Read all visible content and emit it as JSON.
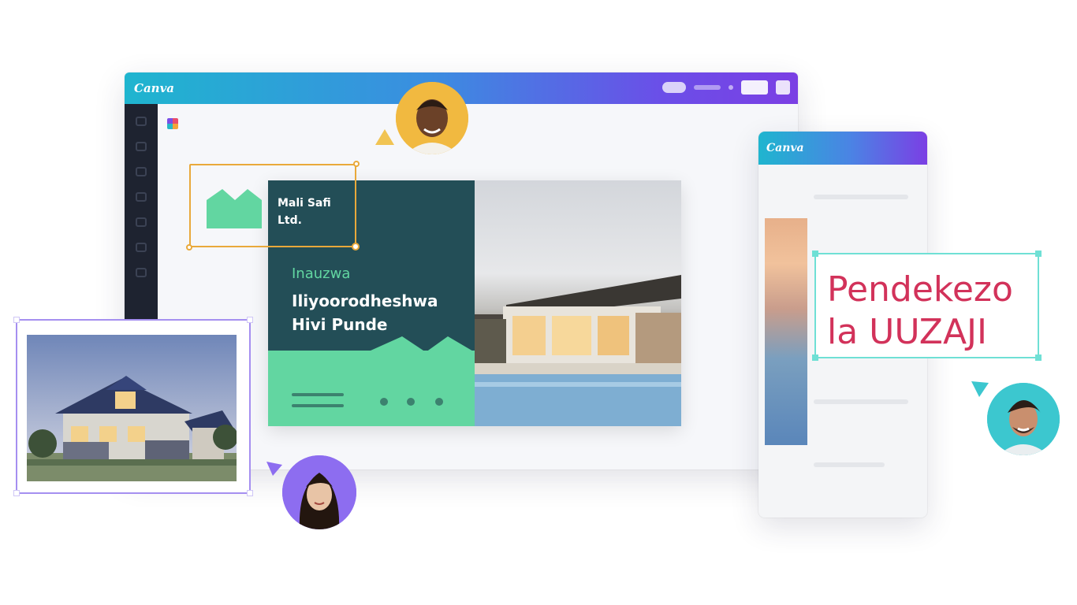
{
  "editor": {
    "logo": "Canva",
    "panel_badge_icon": "colorful-square-icon"
  },
  "slide": {
    "company": "Mali Safi Ltd.",
    "eyebrow": "Inauzwa",
    "headline": "Iliyoorodheshwa Hivi Punde"
  },
  "mobile": {
    "logo": "Canva"
  },
  "proposal": {
    "text": "Pendekezo la UUZAJI"
  },
  "colors": {
    "brand_gradient_start": "#1fb5cf",
    "brand_gradient_end": "#7b3fe4",
    "slide_dark": "#234e57",
    "slide_mint": "#62d6a1",
    "proposal_text": "#d2325a",
    "selection_orange": "#e9a93b",
    "selection_teal": "#6fe0d5",
    "selection_purple": "#a58ff0"
  },
  "avatars": [
    {
      "name": "avatar-man-yellow",
      "cursor_color": "#f1c453"
    },
    {
      "name": "avatar-woman-purple",
      "cursor_color": "#8d6df0"
    },
    {
      "name": "avatar-man-teal",
      "cursor_color": "#3cc7cf"
    }
  ]
}
